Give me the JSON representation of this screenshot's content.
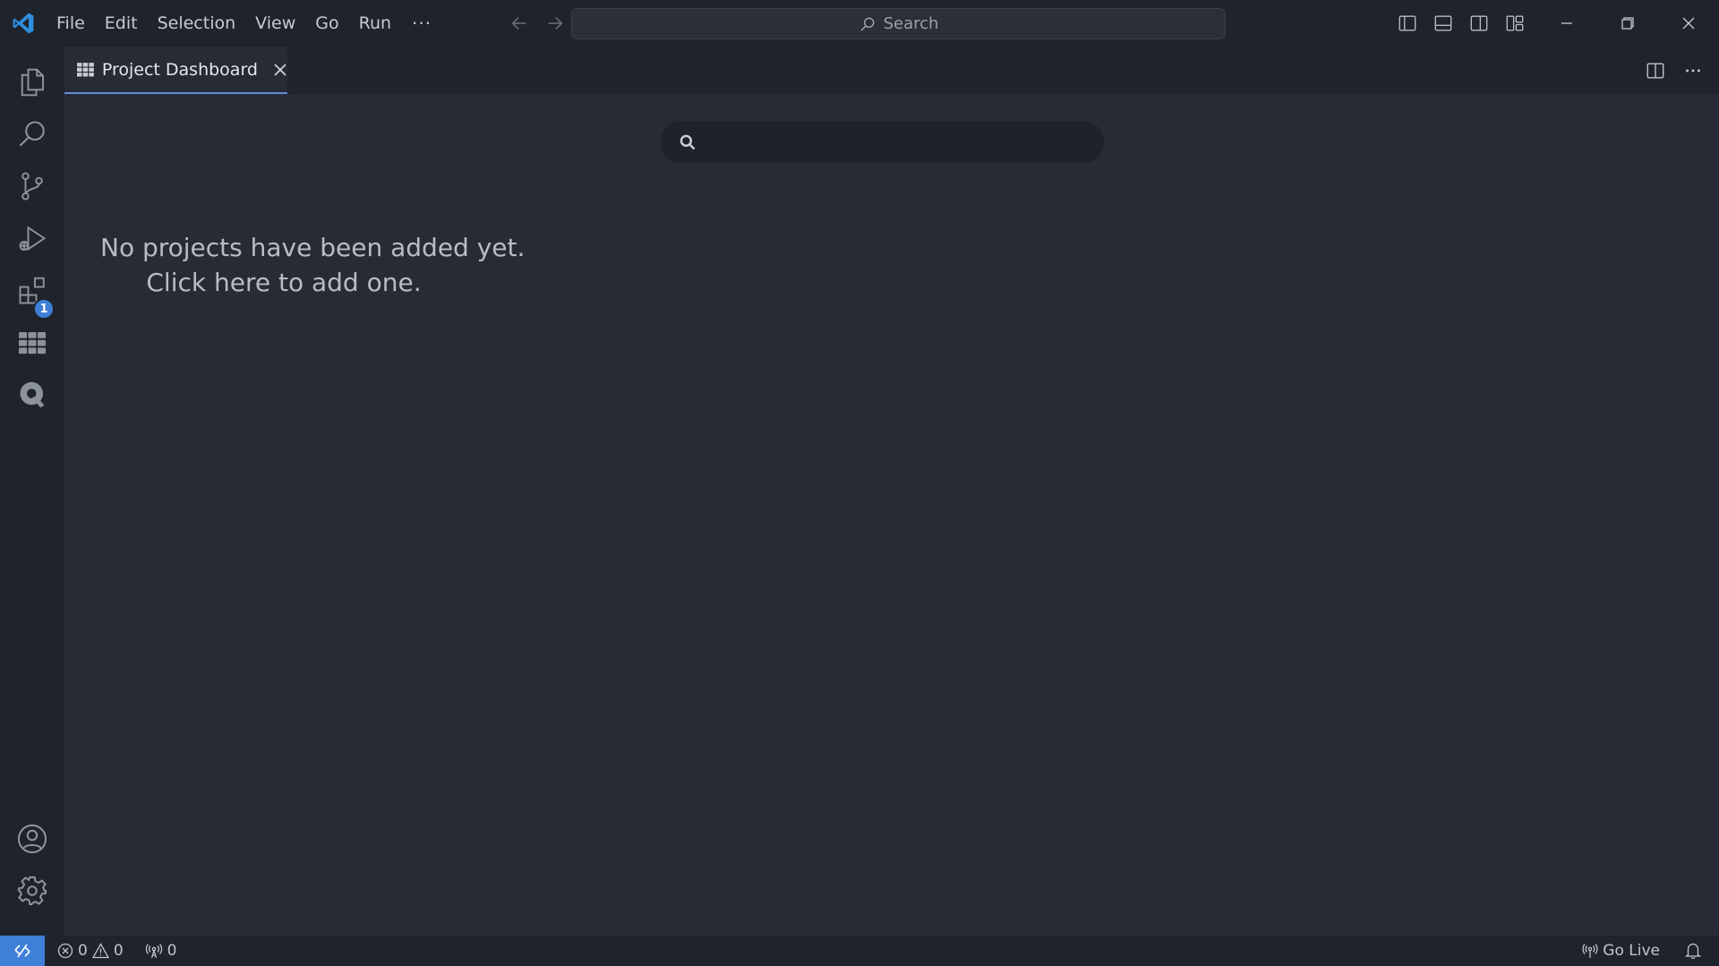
{
  "titlebar": {
    "menu": [
      "File",
      "Edit",
      "Selection",
      "View",
      "Go",
      "Run"
    ],
    "more_label": "···",
    "search_label": "Search"
  },
  "tab": {
    "label": "Project Dashboard"
  },
  "dashboard": {
    "search_placeholder": "",
    "empty_line1": "No projects have been added yet.",
    "empty_line2": "Click here to add one."
  },
  "activitybar": {
    "extensions_badge": "1"
  },
  "statusbar": {
    "errors": "0",
    "warnings": "0",
    "ports": "0",
    "go_live": "Go Live"
  },
  "colors": {
    "accent": "#3f7fd8",
    "titlebar_bg": "#1f232b",
    "editor_bg": "#262b35",
    "logo": "#2f8fe0"
  }
}
